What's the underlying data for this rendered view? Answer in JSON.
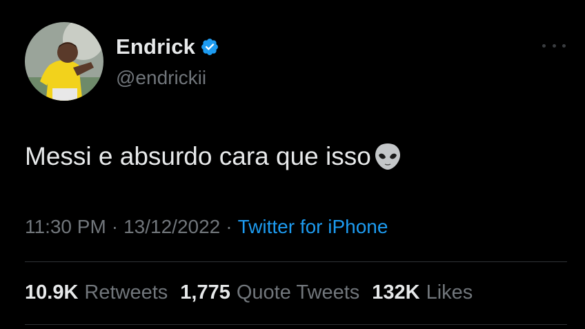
{
  "user": {
    "display_name": "Endrick",
    "handle": "@endrickii"
  },
  "tweet": {
    "text": "Messi e absurdo cara que isso",
    "emoji": "alien-emoji"
  },
  "meta": {
    "time": "11:30 PM",
    "separator": "·",
    "date": "13/12/2022",
    "source": "Twitter for iPhone"
  },
  "stats": {
    "retweets_count": "10.9K",
    "retweets_label": "Retweets",
    "quotes_count": "1,775",
    "quotes_label": "Quote Tweets",
    "likes_count": "132K",
    "likes_label": "Likes"
  },
  "colors": {
    "background": "#000000",
    "text_primary": "#e7e9ea",
    "text_secondary": "#71767b",
    "accent": "#1d9bf0",
    "divider": "#2f3336"
  }
}
